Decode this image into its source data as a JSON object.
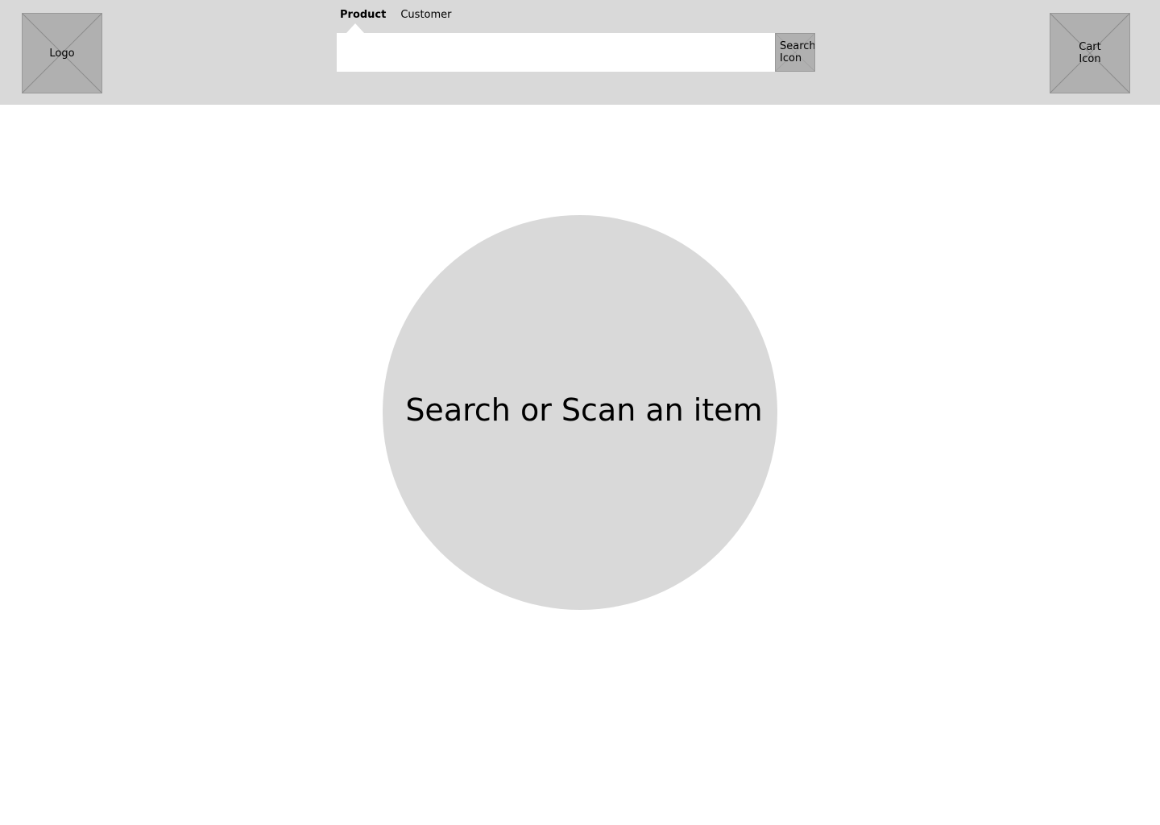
{
  "header": {
    "logo_label": "Logo",
    "tabs": [
      {
        "label": "Product",
        "active": true
      },
      {
        "label": "Customer",
        "active": false
      }
    ],
    "search": {
      "value": "",
      "placeholder": "",
      "button_label": "Search\nIcon"
    },
    "cart_label": "Cart\nIcon"
  },
  "main": {
    "prompt": "Search or Scan an item"
  },
  "colors": {
    "header_bg": "#d9d9d9",
    "placeholder_bg": "#b0b0b0",
    "circle_bg": "#d9d9d9",
    "page_bg": "#ffffff"
  },
  "icons": {
    "logo": "logo-placeholder",
    "search": "search-icon",
    "cart": "cart-icon"
  }
}
